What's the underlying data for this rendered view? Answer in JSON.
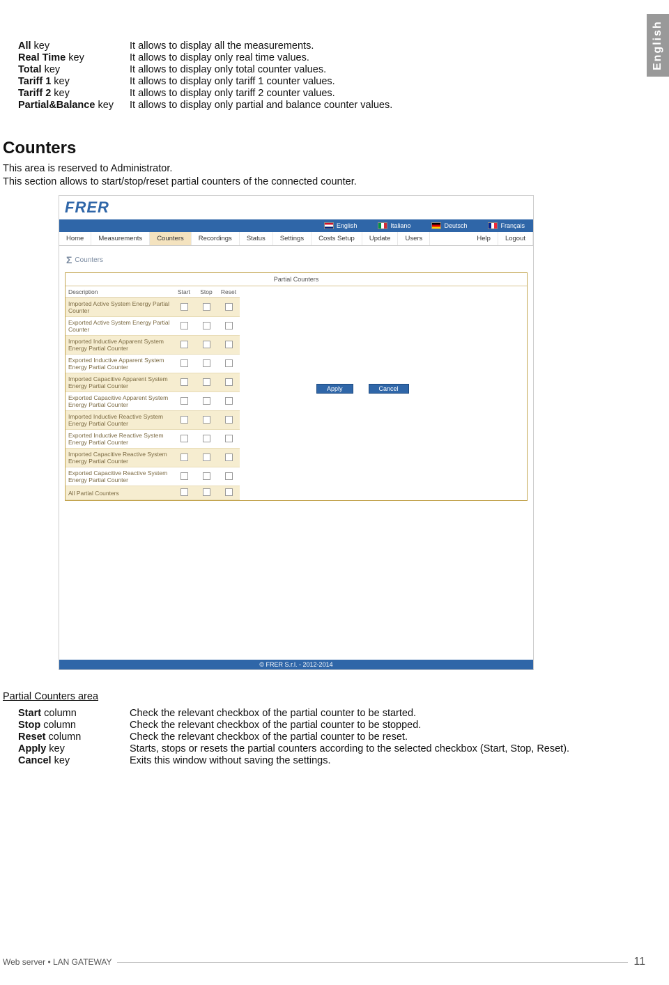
{
  "sideTab": "English",
  "keys_top": [
    {
      "b": "All",
      "rest": " key",
      "v": "It allows to display all the measurements."
    },
    {
      "b": "Real Time",
      "rest": " key",
      "v": "It allows to display only real time values."
    },
    {
      "b": "Total",
      "rest": " key",
      "v": "It allows to display only total counter values."
    },
    {
      "b": "Tariff 1",
      "rest": " key",
      "v": "It allows to display only tariff 1 counter values."
    },
    {
      "b": "Tariff 2",
      "rest": " key",
      "v": "It allows to display only tariff 2 counter values."
    },
    {
      "b": "Partial&Balance",
      "rest": " key",
      "v": "It allows to display only partial and balance counter values."
    }
  ],
  "section_title": "Counters",
  "intro1": "This area is reserved to Administrator.",
  "intro2": "This section allows to start/stop/reset partial counters of the connected counter.",
  "screenshot": {
    "logo": "FRER",
    "langs": [
      {
        "code": "en",
        "label": "English"
      },
      {
        "code": "it",
        "label": "Italiano"
      },
      {
        "code": "de",
        "label": "Deutsch"
      },
      {
        "code": "fr",
        "label": "Français"
      }
    ],
    "menu": [
      "Home",
      "Measurements",
      "Counters",
      "Recordings",
      "Status",
      "Settings",
      "Costs Setup",
      "Update",
      "Users",
      "Help",
      "Logout"
    ],
    "menu_active_index": 2,
    "crumb": "Counters",
    "panel_title": "Partial Counters",
    "columns": [
      "Description",
      "Start",
      "Stop",
      "Reset"
    ],
    "rows": [
      "Imported Active System Energy Partial Counter",
      "Exported Active System Energy Partial Counter",
      "Imported Inductive Apparent System Energy Partial Counter",
      "Exported Inductive Apparent System Energy Partial Counter",
      "Imported Capacitive Apparent System Energy Partial Counter",
      "Exported Capacitive Apparent System Energy Partial Counter",
      "Imported Inductive Reactive System Energy Partial Counter",
      "Exported Inductive Reactive System Energy Partial Counter",
      "Imported Capacitive Reactive System Energy Partial Counter",
      "Exported Capacitive Reactive System Energy Partial Counter",
      "All Partial Counters"
    ],
    "btn_apply": "Apply",
    "btn_cancel": "Cancel",
    "footer": "© FRER S.r.l. - 2012-2014"
  },
  "sub_heading": "Partial Counters area",
  "keys_bottom": [
    {
      "b": "Start",
      "rest": " column",
      "v": "Check the relevant checkbox of the partial counter to be started."
    },
    {
      "b": "Stop",
      "rest": " column",
      "v": "Check the relevant checkbox of the partial counter to be stopped."
    },
    {
      "b": "Reset",
      "rest": " column",
      "v": "Check the relevant checkbox of the partial counter to be reset."
    },
    {
      "b": "Apply",
      "rest": " key",
      "v": "Starts, stops or resets the partial counters according to the selected checkbox (Start, Stop, Reset)."
    },
    {
      "b": "Cancel",
      "rest": " key",
      "v": "Exits this window without saving the settings."
    }
  ],
  "footer_text": "Web server • LAN GATEWAY",
  "page_number": "11"
}
